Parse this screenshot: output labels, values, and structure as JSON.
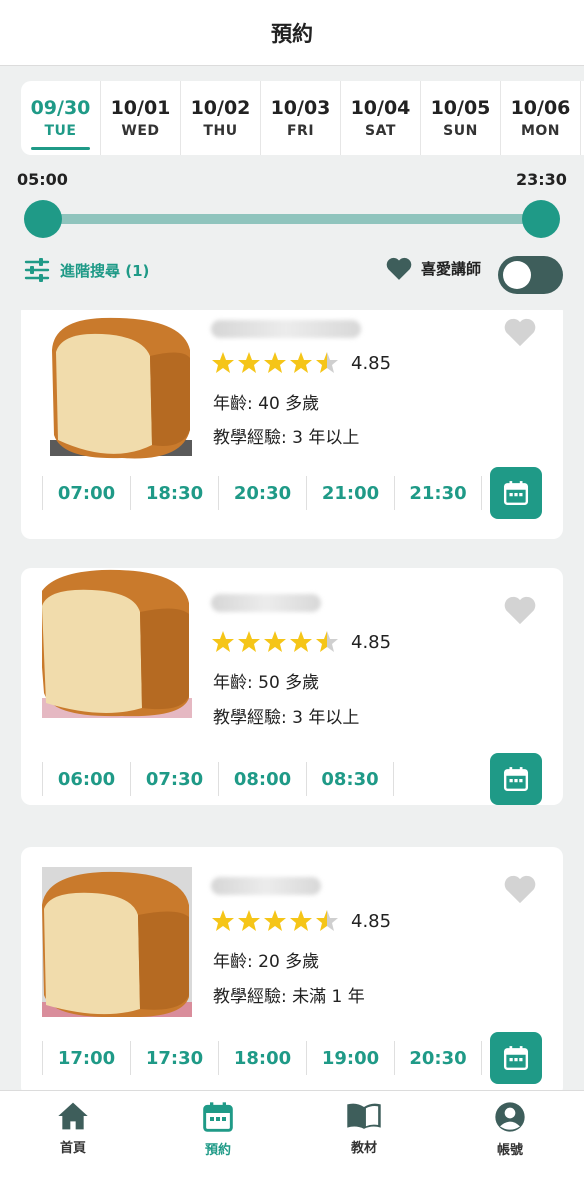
{
  "header": {
    "title": "預約"
  },
  "dates": [
    {
      "date": "09/30",
      "weekday": "TUE",
      "selected": true
    },
    {
      "date": "10/01",
      "weekday": "WED"
    },
    {
      "date": "10/02",
      "weekday": "THU"
    },
    {
      "date": "10/03",
      "weekday": "FRI"
    },
    {
      "date": "10/04",
      "weekday": "SAT"
    },
    {
      "date": "10/05",
      "weekday": "SUN"
    },
    {
      "date": "10/06",
      "weekday": "MON"
    }
  ],
  "time_range": {
    "start": "05:00",
    "end": "23:30"
  },
  "filter": {
    "label": "進階搜尋 (1)",
    "icon": "sliders-icon"
  },
  "favorites": {
    "label": "喜愛講師",
    "icon": "heart-icon",
    "toggle_on": false
  },
  "colors": {
    "accent": "#1f9a87",
    "track": "#8fc4bd",
    "star": "#f5c518",
    "toggle": "#3e5e5b"
  },
  "teachers": [
    {
      "rating": "4.85",
      "stars": 4.85,
      "age": "年齡: 40 多歲",
      "experience": "教學經驗: 3 年以上",
      "slots": [
        "07:00",
        "18:30",
        "20:30",
        "21:00",
        "21:30"
      ]
    },
    {
      "rating": "4.85",
      "stars": 4.85,
      "age": "年齡: 50 多歲",
      "experience": "教學經驗: 3 年以上",
      "slots": [
        "06:00",
        "07:30",
        "08:00",
        "08:30"
      ]
    },
    {
      "rating": "4.85",
      "stars": 4.85,
      "age": "年齡: 20 多歲",
      "experience": "教學經驗: 未滿 1 年",
      "slots": [
        "17:00",
        "17:30",
        "18:00",
        "19:00",
        "20:30"
      ]
    }
  ],
  "nav": [
    {
      "label": "首頁",
      "icon": "home-icon"
    },
    {
      "label": "預約",
      "icon": "calendar-icon",
      "active": true
    },
    {
      "label": "教材",
      "icon": "book-icon"
    },
    {
      "label": "帳號",
      "icon": "account-icon"
    }
  ]
}
